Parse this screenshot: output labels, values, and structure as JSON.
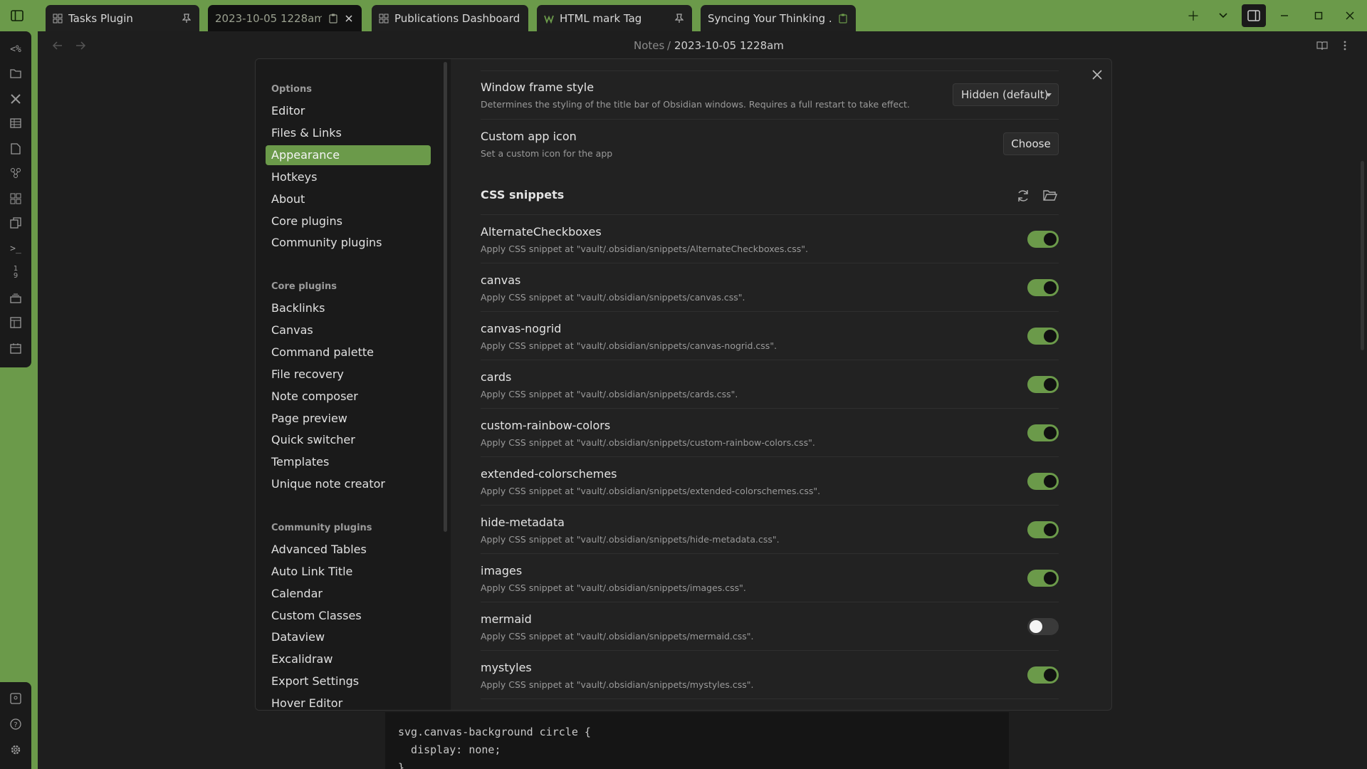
{
  "tabs": [
    {
      "label": "Tasks Plugin",
      "end_icon": "pin-icon"
    },
    {
      "label": "2023-10-05 1228am",
      "end_icon": "close-icon",
      "active": true
    },
    {
      "label": "Publications Dashboard",
      "end_icon": ""
    },
    {
      "label": "HTML mark Tag",
      "end_icon": "pin-icon"
    },
    {
      "label": "Syncing Your Thinking ...",
      "end_icon": "clipboard-icon"
    }
  ],
  "breadcrumb": {
    "folder": "Notes",
    "separator": "/",
    "note": "2023-10-05 1228am"
  },
  "settings_nav": {
    "options_header": "Options",
    "options": [
      "Editor",
      "Files & Links",
      "Appearance",
      "Hotkeys",
      "About",
      "Core plugins",
      "Community plugins"
    ],
    "core_header": "Core plugins",
    "core": [
      "Backlinks",
      "Canvas",
      "Command palette",
      "File recovery",
      "Note composer",
      "Page preview",
      "Quick switcher",
      "Templates",
      "Unique note creator"
    ],
    "community_header": "Community plugins",
    "community": [
      "Advanced Tables",
      "Auto Link Title",
      "Calendar",
      "Custom Classes",
      "Dataview",
      "Excalidraw",
      "Export Settings",
      "Hover Editor"
    ]
  },
  "appearance": {
    "window_frame": {
      "name": "Window frame style",
      "desc": "Determines the styling of the title bar of Obsidian windows. Requires a full restart to take effect.",
      "value": "Hidden (default)"
    },
    "app_icon": {
      "name": "Custom app icon",
      "desc": "Set a custom icon for the app",
      "button": "Choose"
    },
    "snippets_heading": "CSS snippets",
    "snippets": [
      {
        "name": "AlternateCheckboxes",
        "desc": "Apply CSS snippet at \"vault/.obsidian/snippets/AlternateCheckboxes.css\".",
        "enabled": true
      },
      {
        "name": "canvas",
        "desc": "Apply CSS snippet at \"vault/.obsidian/snippets/canvas.css\".",
        "enabled": true
      },
      {
        "name": "canvas-nogrid",
        "desc": "Apply CSS snippet at \"vault/.obsidian/snippets/canvas-nogrid.css\".",
        "enabled": true
      },
      {
        "name": "cards",
        "desc": "Apply CSS snippet at \"vault/.obsidian/snippets/cards.css\".",
        "enabled": true
      },
      {
        "name": "custom-rainbow-colors",
        "desc": "Apply CSS snippet at \"vault/.obsidian/snippets/custom-rainbow-colors.css\".",
        "enabled": true
      },
      {
        "name": "extended-colorschemes",
        "desc": "Apply CSS snippet at \"vault/.obsidian/snippets/extended-colorschemes.css\".",
        "enabled": true
      },
      {
        "name": "hide-metadata",
        "desc": "Apply CSS snippet at \"vault/.obsidian/snippets/hide-metadata.css\".",
        "enabled": true
      },
      {
        "name": "images",
        "desc": "Apply CSS snippet at \"vault/.obsidian/snippets/images.css\".",
        "enabled": true
      },
      {
        "name": "mermaid",
        "desc": "Apply CSS snippet at \"vault/.obsidian/snippets/mermaid.css\".",
        "enabled": false
      },
      {
        "name": "mystyles",
        "desc": "Apply CSS snippet at \"vault/.obsidian/snippets/mystyles.css\".",
        "enabled": true
      }
    ]
  },
  "code": {
    "line1": "svg.canvas-background circle {",
    "line2": "  display: none;",
    "line3": "}"
  },
  "colors": {
    "accent": "#6b9a4a",
    "background": "#1e1e1e",
    "modal": "#222222",
    "nav": "#1a1a1a"
  }
}
